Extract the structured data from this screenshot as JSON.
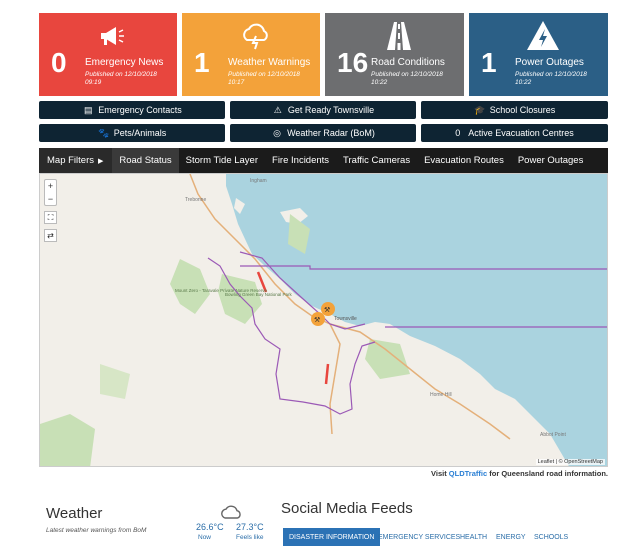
{
  "tiles": [
    {
      "count": "0",
      "title": "Emergency News",
      "published": "Published on 12/10/2018",
      "time": "09:19",
      "icon": "megaphone-icon",
      "color": "#e8463e"
    },
    {
      "count": "1",
      "title": "Weather Warnings",
      "published": "Published on 12/10/2018",
      "time": "10:17",
      "icon": "storm-cloud-icon",
      "color": "#f3a23a"
    },
    {
      "count": "16",
      "title": "Road Conditions",
      "published": "Published on 12/10/2018",
      "time": "10:22",
      "icon": "road-icon",
      "color": "#6d6e70"
    },
    {
      "count": "1",
      "title": "Power Outages",
      "published": "Published on 12/10/2018",
      "time": "10:22",
      "icon": "power-warning-icon",
      "color": "#2b5f86"
    }
  ],
  "links": {
    "emergency_contacts": "Emergency Contacts",
    "get_ready": "Get Ready Townsville",
    "school_closures": "School Closures",
    "pets": "Pets/Animals",
    "weather_radar": "Weather Radar (BoM)",
    "evac_count": "0",
    "evac_label": "Active Evacuation Centres"
  },
  "map": {
    "filters_label": "Map Filters",
    "tabs": [
      "Road Status",
      "Storm Tide Layer",
      "Fire Incidents",
      "Traffic Cameras",
      "Evacuation Routes",
      "Power Outages"
    ],
    "zoom_in": "+",
    "zoom_out": "−",
    "places": [
      "Ingham",
      "Trebonne",
      "Mount Zero - Taravale Private Nature Reserve",
      "Bowling Green Bay National Park",
      "Townsville",
      "Home Hill",
      "Abbot Point"
    ],
    "attribution": "Leaflet | © OpenStreetMap",
    "visit_prefix": "Visit",
    "visit_link": "QLDTraffic",
    "visit_suffix": "for Queensland road information."
  },
  "weather": {
    "heading": "Weather",
    "sub": "Latest weather warnings from BoM",
    "now_temp": "26.6°C",
    "now_label": "Now",
    "feels_temp": "27.3°C",
    "feels_label": "Feels like",
    "icon": "cloud-icon"
  },
  "social": {
    "heading": "Social Media Feeds",
    "tabs": [
      "DISASTER INFORMATION",
      "EMERGENCY SERVICES",
      "HEALTH",
      "ENERGY",
      "SCHOOLS"
    ]
  },
  "colors": {
    "dark_button": "#0e2433",
    "link_blue": "#2b6ea8",
    "active_tab": "#2b72b5",
    "sea": "#aad3df"
  }
}
